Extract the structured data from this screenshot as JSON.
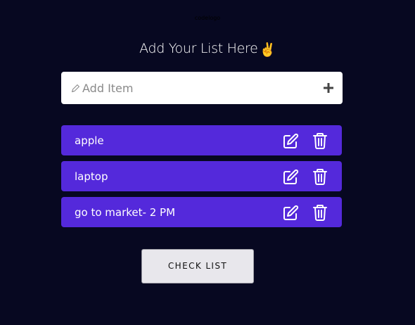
{
  "header": {
    "logo_text": "codelogo",
    "title": "Add Your List Here",
    "title_emoji": "✌"
  },
  "add_form": {
    "placeholder": "Add Item",
    "placeholder_icon": "pen-icon",
    "add_icon": "plus-icon",
    "value": ""
  },
  "items": [
    {
      "label": "apple",
      "edit_icon": "edit-icon",
      "delete_icon": "trash-icon"
    },
    {
      "label": "laptop",
      "edit_icon": "edit-icon",
      "delete_icon": "trash-icon"
    },
    {
      "label": "go to market- 2 PM",
      "edit_icon": "edit-icon",
      "delete_icon": "trash-icon"
    }
  ],
  "footer": {
    "check_button_label": "CHECK LIST"
  },
  "colors": {
    "background": "#070821",
    "item_bg": "#5429db",
    "input_bg": "#ffffff",
    "button_bg": "#e8e7ec"
  }
}
